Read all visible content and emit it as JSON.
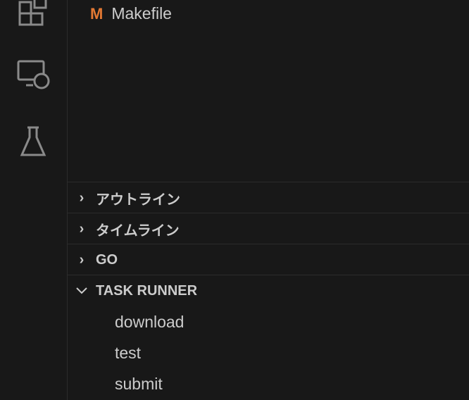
{
  "explorer": {
    "file": "Makefile",
    "file_icon": "M"
  },
  "sections": [
    {
      "label": "アウトライン",
      "expanded": false
    },
    {
      "label": "タイムライン",
      "expanded": false
    },
    {
      "label": "GO",
      "expanded": false
    },
    {
      "label": "TASK RUNNER",
      "expanded": true
    }
  ],
  "tasks": [
    "download",
    "test",
    "submit"
  ]
}
